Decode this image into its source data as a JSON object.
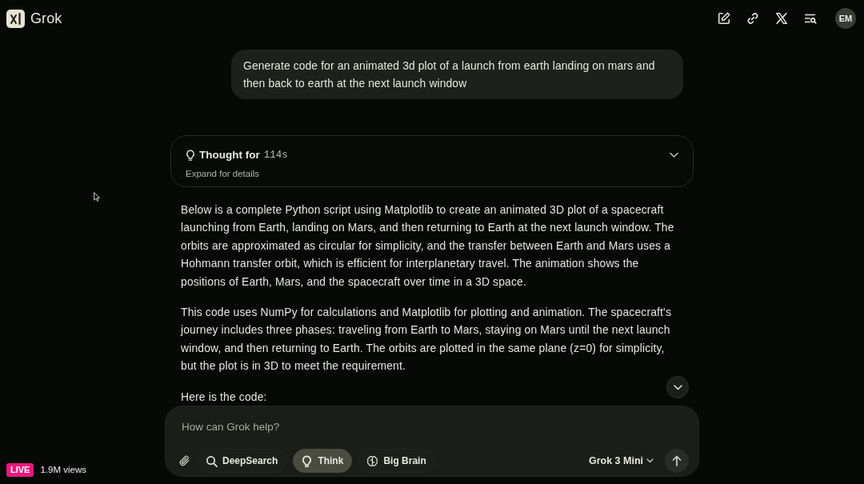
{
  "header": {
    "title": "Grok",
    "avatar": "EM"
  },
  "prompt": {
    "text": "Generate code for an animated 3d plot of a launch from earth landing on mars and then back to earth at the next launch window"
  },
  "thought": {
    "label": "Thought for",
    "duration": "114s",
    "hint": "Expand for details",
    "expanded": false
  },
  "answer": {
    "paragraphs": [
      "Below is a complete Python script using Matplotlib to create an animated 3D plot of a spacecraft launching from Earth, landing on Mars, and then returning to Earth at the next launch window. The orbits are approximated as circular for simplicity, and the transfer between Earth and Mars uses a Hohmann transfer orbit, which is efficient for interplanetary travel. The animation shows the positions of Earth, Mars, and the spacecraft over time in a 3D space.",
      "This code uses NumPy for calculations and Matplotlib for plotting and animation. The spacecraft's journey includes three phases: traveling from Earth to Mars, staying on Mars until the next launch window, and then returning to Earth. The orbits are plotted in the same plane (z=0) for simplicity, but the plot is in 3D to meet the requirement.",
      "Here is the code:"
    ]
  },
  "composer": {
    "placeholder": "How can Grok help?",
    "tools": [
      {
        "label": "DeepSearch",
        "kind": "search",
        "selected": false
      },
      {
        "label": "Think",
        "kind": "bulb",
        "selected": true
      },
      {
        "label": "Big Brain",
        "kind": "brain",
        "selected": false
      }
    ],
    "model": "Grok 3 Mini"
  },
  "stream": {
    "badge": "LIVE",
    "views": "1.9M views"
  }
}
